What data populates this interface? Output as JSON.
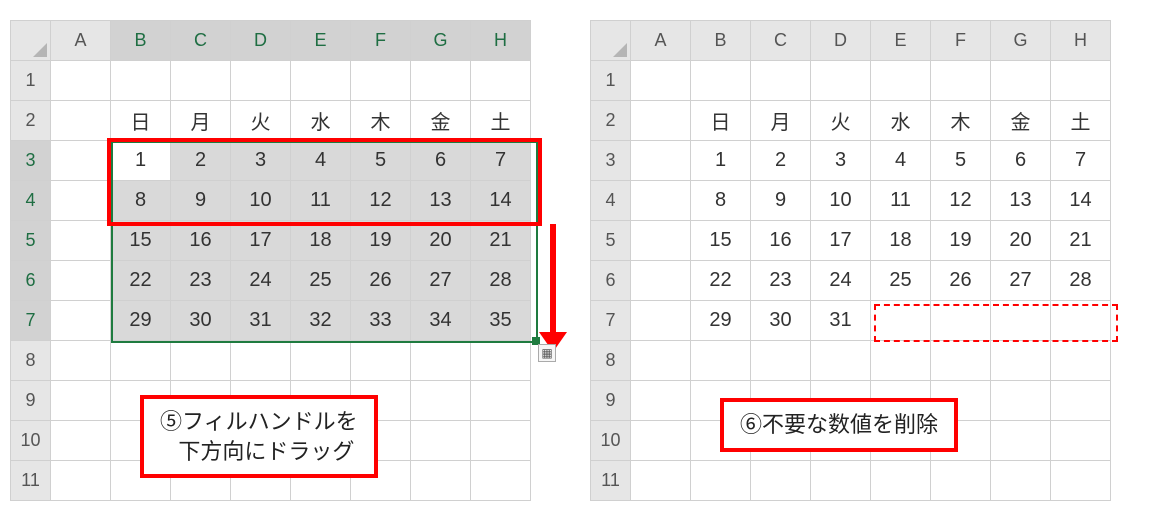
{
  "columns": [
    "A",
    "B",
    "C",
    "D",
    "E",
    "F",
    "G",
    "H"
  ],
  "row_hdrs": [
    "1",
    "2",
    "3",
    "4",
    "5",
    "6",
    "7",
    "8",
    "9",
    "10",
    "11"
  ],
  "days_row": [
    "日",
    "月",
    "火",
    "水",
    "木",
    "金",
    "土"
  ],
  "left": {
    "selected_cols": [
      "B",
      "C",
      "D",
      "E",
      "F",
      "G",
      "H"
    ],
    "selected_rows": [
      "3",
      "4",
      "5",
      "6",
      "7"
    ],
    "grid_rows": [
      [
        "1",
        "2",
        "3",
        "4",
        "5",
        "6",
        "7"
      ],
      [
        "8",
        "9",
        "10",
        "11",
        "12",
        "13",
        "14"
      ],
      [
        "15",
        "16",
        "17",
        "18",
        "19",
        "20",
        "21"
      ],
      [
        "22",
        "23",
        "24",
        "25",
        "26",
        "27",
        "28"
      ],
      [
        "29",
        "30",
        "31",
        "32",
        "33",
        "34",
        "35"
      ]
    ],
    "callout_step": "⑤",
    "callout_l1": "フィルハンドルを",
    "callout_l2": "下方向にドラッグ"
  },
  "right": {
    "grid_rows": [
      [
        "1",
        "2",
        "3",
        "4",
        "5",
        "6",
        "7"
      ],
      [
        "8",
        "9",
        "10",
        "11",
        "12",
        "13",
        "14"
      ],
      [
        "15",
        "16",
        "17",
        "18",
        "19",
        "20",
        "21"
      ],
      [
        "22",
        "23",
        "24",
        "25",
        "26",
        "27",
        "28"
      ],
      [
        "29",
        "30",
        "31",
        "",
        "",
        "",
        ""
      ]
    ],
    "callout_step": "⑥",
    "callout_text": "不要な数値を削除"
  },
  "chart_data": {
    "type": "table",
    "note": "Two Excel-style grids showing calendar fill via drag (left) then deleting extra values (right).",
    "columns": [
      "B",
      "C",
      "D",
      "E",
      "F",
      "G",
      "H"
    ],
    "header_row_index": 2,
    "header_row": [
      "日",
      "月",
      "火",
      "水",
      "木",
      "金",
      "土"
    ],
    "left_grid_start_row": 3,
    "left_grid": [
      [
        1,
        2,
        3,
        4,
        5,
        6,
        7
      ],
      [
        8,
        9,
        10,
        11,
        12,
        13,
        14
      ],
      [
        15,
        16,
        17,
        18,
        19,
        20,
        21
      ],
      [
        22,
        23,
        24,
        25,
        26,
        27,
        28
      ],
      [
        29,
        30,
        31,
        32,
        33,
        34,
        35
      ]
    ],
    "right_grid_start_row": 3,
    "right_grid": [
      [
        1,
        2,
        3,
        4,
        5,
        6,
        7
      ],
      [
        8,
        9,
        10,
        11,
        12,
        13,
        14
      ],
      [
        15,
        16,
        17,
        18,
        19,
        20,
        21
      ],
      [
        22,
        23,
        24,
        25,
        26,
        27,
        28
      ],
      [
        29,
        30,
        31,
        null,
        null,
        null,
        null
      ]
    ],
    "active_cell_left": "B3",
    "initial_selection_left": "B3:H4",
    "fill_range_left": "B3:H7",
    "deleted_range_right": "E7:H7",
    "captions": {
      "left": "⑤フィルハンドルを下方向にドラッグ",
      "right": "⑥不要な数値を削除"
    }
  }
}
